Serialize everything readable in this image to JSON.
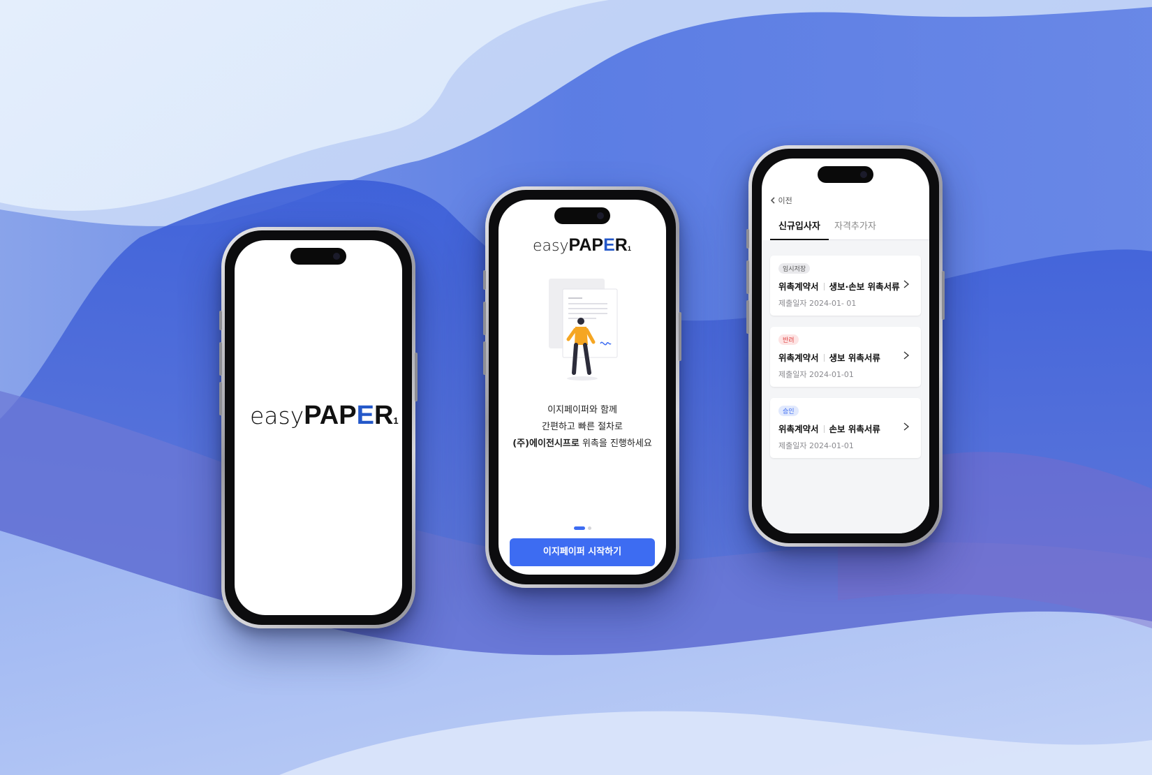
{
  "phone1": {
    "logo": {
      "easy": "easy",
      "pap": "PAP",
      "e": "E",
      "r": "R",
      "one": "1"
    }
  },
  "phone2": {
    "logo": {
      "easy": "easy",
      "pap": "PAP",
      "e": "E",
      "r": "R",
      "one": "1"
    },
    "line1": "이지페이퍼와 함께",
    "line2": "간편하고 빠른 절차로",
    "line3_bold": "(주)에이전시프로",
    "line3_rest": " 위촉을 진행하세요",
    "cta_label": "이지페이퍼 시작하기",
    "pager": {
      "total": 2,
      "active": 1
    }
  },
  "phone3": {
    "back_label": "이전",
    "tabs": [
      {
        "label": "신규입사자",
        "active": true
      },
      {
        "label": "자격추가자",
        "active": false
      }
    ],
    "cards": [
      {
        "badge": "임시저장",
        "badge_color": "#e9e9ec",
        "badge_text_color": "#555555",
        "doc": "위촉계약서",
        "type": "생보·손보 위촉서류",
        "date": "제출일자 2024-01- 01"
      },
      {
        "badge": "반려",
        "badge_color": "#fde4e4",
        "badge_text_color": "#e04848",
        "doc": "위촉계약서",
        "type": "생보 위촉서류",
        "date": "제출일자 2024-01-01"
      },
      {
        "badge": "승인",
        "badge_color": "#e1e9fd",
        "badge_text_color": "#3d6cf2",
        "doc": "위촉계약서",
        "type": "손보 위촉서류",
        "date": "제출일자 2024-01-01"
      }
    ]
  },
  "colors": {
    "accent": "#3d6cf2",
    "logo_e": "#2458c9"
  }
}
